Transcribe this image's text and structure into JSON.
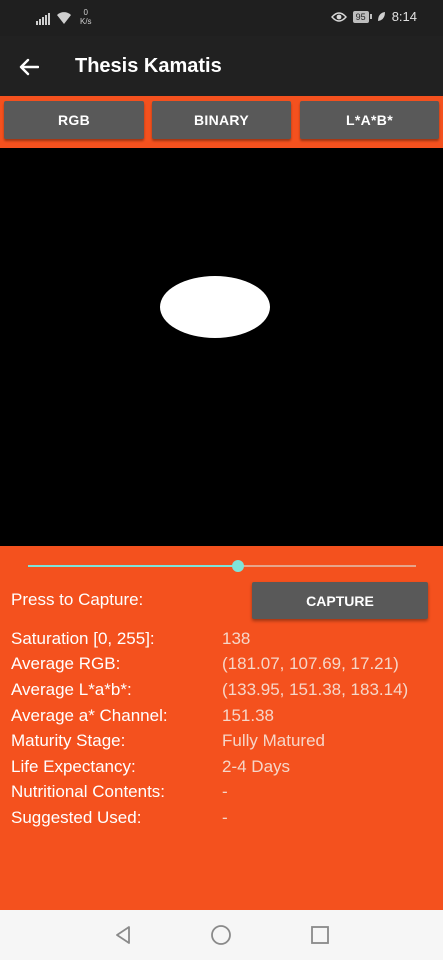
{
  "status_bar": {
    "net_speed_value": "0",
    "net_speed_unit": "K/s",
    "battery": "95",
    "time": "8:14"
  },
  "app_bar": {
    "title": "Thesis Kamatis",
    "back_icon": "arrow-back-icon"
  },
  "mode_buttons": [
    "RGB",
    "BINARY",
    "L*A*B*"
  ],
  "slider": {
    "value": 0.54
  },
  "capture": {
    "label": "Press to Capture:",
    "button_label": "CAPTURE"
  },
  "info": [
    {
      "label": "Saturation [0, 255]:",
      "value": "138"
    },
    {
      "label": "Average RGB:",
      "value": "(181.07, 107.69, 17.21)"
    },
    {
      "label": "Average L*a*b*:",
      "value": "(133.95, 151.38, 183.14)"
    },
    {
      "label": "Average a* Channel:",
      "value": "151.38"
    },
    {
      "label": "Maturity Stage:",
      "value": "Fully Matured"
    },
    {
      "label": "Life Expectancy:",
      "value": "2-4 Days"
    },
    {
      "label": "Nutritional Contents:",
      "value": "-"
    },
    {
      "label": "Suggested Used:",
      "value": "-"
    }
  ],
  "nav_bar": {
    "icons": [
      "back-triangle-icon",
      "home-circle-icon",
      "recents-square-icon"
    ]
  },
  "colors": {
    "accent": "#f4511e",
    "app_bar": "#212121",
    "button": "#595959",
    "slider": "#7fe3d8"
  }
}
